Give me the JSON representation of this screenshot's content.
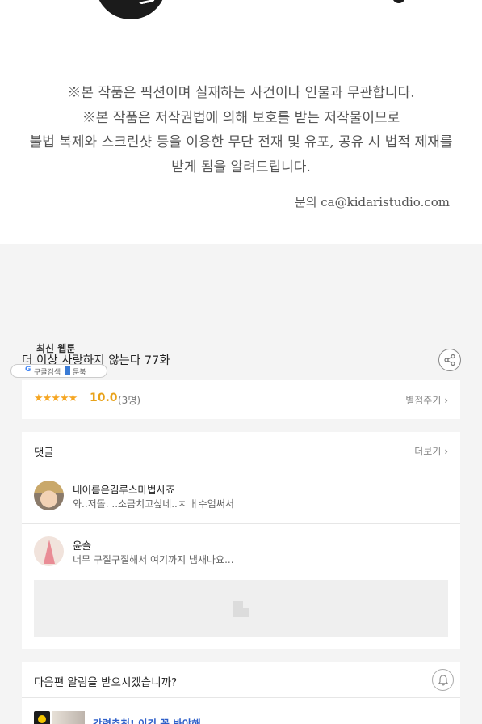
{
  "notice": {
    "line1": "※본 작품은 픽션이며 실재하는 사건이나 인물과 무관합니다.",
    "line2": "※본 작품은 저작권법에 의해 보호를 받는 저작물이므로",
    "line3": "불법 복제와 스크린샷 등을 이용한 무단 전재 및 유포, 공유 시 법적 제재를",
    "line4": "받게 됨을 알려드립니다.",
    "contact": "문의 ca@kidaristudio.com"
  },
  "episode": {
    "title": "더 이상 사랑하지 않는다 77화"
  },
  "overlay": {
    "label": "최신 웹툰",
    "search_g": "G",
    "search_text": "구글검색",
    "bookmark_text": "툰북"
  },
  "rating": {
    "stars": "★★★★★",
    "score": "10.0",
    "count": "(3명)",
    "rate_link": "별점주기 ›"
  },
  "comments": {
    "title": "댓글",
    "more": "더보기 ›",
    "items": [
      {
        "name": "내이름은김루스마법사죠",
        "text": "와..저돌. ..소금치고싶네..ㅈ ㅐ수엄써서"
      },
      {
        "name": "윤슬",
        "text": "너무 구질구질해서 여기까지 냄새나요..."
      }
    ]
  },
  "notify": {
    "title": "다음편 알림을 받으시겠습니까?",
    "recommend_title": "강력추천! 이건 꼭 봐야해"
  },
  "icons": {
    "share": "share-icon",
    "bell": "bell-icon",
    "star": "star-icon"
  },
  "colors": {
    "star": "#f5a623",
    "score": "#e8a21a",
    "link_blue": "#2e5fc9"
  }
}
